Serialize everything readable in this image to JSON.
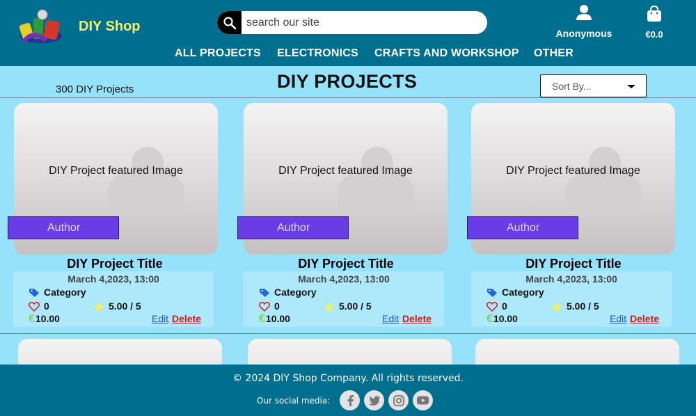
{
  "header": {
    "brand": "DIY Shop",
    "search_placeholder": "search our site",
    "user_name": "Anonymous",
    "cart_total": "€0.0",
    "nav": [
      "ALL PROJECTS",
      "ELECTRONICS",
      "CRAFTS AND WORKSHOP",
      "OTHER"
    ]
  },
  "toolbar": {
    "count": "300 DIY Projects",
    "title": "DIY PROJECTS",
    "sort_label": "Sort By..."
  },
  "cards": [
    {
      "image_caption": "DIY Project featured Image",
      "author": "Author",
      "title": "DIY Project Title",
      "date": "March 4,2023, 13:00",
      "category": "Category",
      "likes": "0",
      "rating": "5.00 / 5",
      "price": "10.00",
      "edit": "Edit",
      "delete": "Delete"
    },
    {
      "image_caption": "DIY Project featured Image",
      "author": "Author",
      "title": "DIY Project Title",
      "date": "March 4,2023, 13:00",
      "category": "Category",
      "likes": "0",
      "rating": "5.00 / 5",
      "price": "10.00",
      "edit": "Edit",
      "delete": "Delete"
    },
    {
      "image_caption": "DIY Project featured Image",
      "author": "Author",
      "title": "DIY Project Title",
      "date": "March 4,2023, 13:00",
      "category": "Category",
      "likes": "0",
      "rating": "5.00 / 5",
      "price": "10.00",
      "edit": "Edit",
      "delete": "Delete"
    }
  ],
  "icons": {
    "category": "tag-icon",
    "likes": "heart-icon",
    "rating": "star-icon",
    "price": "euro-icon"
  },
  "footer": {
    "copyright": "© 2024 DIY Shop Company.  All rights reserved.",
    "social_label": "Our social media:",
    "social": [
      "facebook-icon",
      "twitter-icon",
      "instagram-icon",
      "youtube-icon"
    ]
  },
  "colors": {
    "header_bg": "#006f8f",
    "page_bg": "#96e2fa",
    "brand": "#f4f36a",
    "author_bg": "#6a3ce6"
  }
}
